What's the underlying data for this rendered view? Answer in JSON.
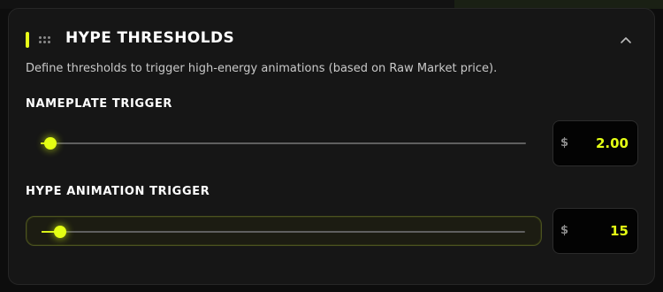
{
  "section": {
    "title": "HYPE THRESHOLDS",
    "description": "Define thresholds to trigger high-energy animations (based on Raw Market price)."
  },
  "colors": {
    "accent": "#e4ff14",
    "panel": "#161616",
    "value_box": "#030303"
  },
  "icons": {
    "drag_handle": "grip-dots-icon",
    "collapse": "chevron-up-icon"
  },
  "nameplate_trigger": {
    "label": "NAMEPLATE TRIGGER",
    "currency": "$",
    "value": "2.00",
    "slider_position": 0.02
  },
  "hype_animation_trigger": {
    "label": "HYPE ANIMATION TRIGGER",
    "currency": "$",
    "value": "15",
    "slider_position": 0.038
  }
}
